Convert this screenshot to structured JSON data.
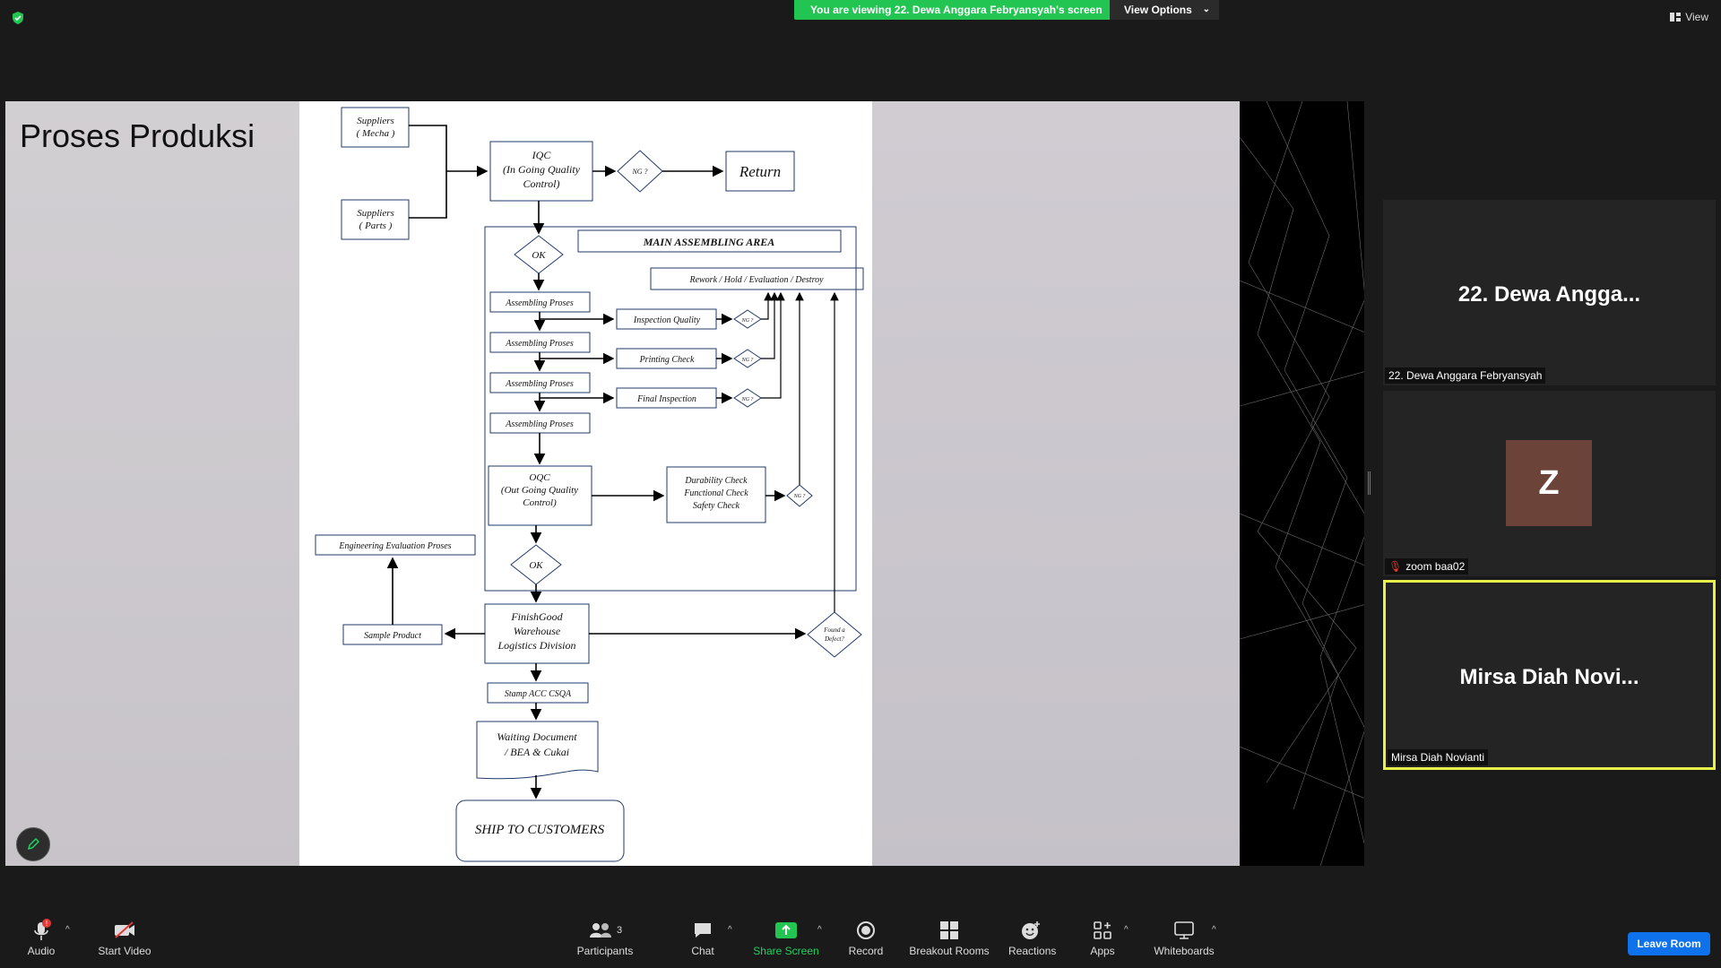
{
  "banner": {
    "text": "You are viewing 22. Dewa Anggara Febryansyah's screen"
  },
  "view_options": {
    "label": "View Options"
  },
  "view_button": {
    "label": "View"
  },
  "slide": {
    "title": "Proses Produksi",
    "flowchart": {
      "suppliers_mecha": [
        "Suppliers",
        "( Mecha )"
      ],
      "suppliers_parts": [
        "Suppliers",
        "( Parts )"
      ],
      "iqc": [
        "IQC",
        "(In Going Quality",
        "Control)"
      ],
      "ng": "NG ?",
      "return": "Return",
      "main_area": "MAIN ASSEMBLING AREA",
      "ok": "OK",
      "rework": "Rework / Hold / Evaluation / Destroy",
      "assembling": "Assembling Proses",
      "inspection_quality": "Inspection Quality",
      "printing_check": "Printing Check",
      "final_inspection": "Final Inspection",
      "oqc": [
        "OQC",
        "(Out Going Quality",
        "Control)"
      ],
      "durability": [
        "Durability Check",
        "Functional Check",
        "Safety Check"
      ],
      "engineering": "Engineering Evaluation Proses",
      "sample_product": "Sample Product",
      "finishgood": [
        "FinishGood",
        "Warehouse",
        "Logistics Division"
      ],
      "found_defect": [
        "Found a",
        "Defect?"
      ],
      "stamp": "Stamp ACC CSQA",
      "waiting": [
        "Waiting Document",
        "/ BEA & Cukai"
      ],
      "ship": "SHIP TO CUSTOMERS"
    }
  },
  "participants_panel": [
    {
      "display_name": "22. Dewa Angga...",
      "label": "22. Dewa Anggara Febryansyah"
    },
    {
      "avatar_letter": "Z",
      "label": "zoom baa02"
    },
    {
      "display_name": "Mirsa Diah Novi...",
      "label": "Mirsa Diah Novianti"
    }
  ],
  "toolbar": {
    "audio": "Audio",
    "start_video": "Start Video",
    "participants": "Participants",
    "participants_count": "3",
    "chat": "Chat",
    "share_screen": "Share Screen",
    "record": "Record",
    "breakout_rooms": "Breakout Rooms",
    "reactions": "Reactions",
    "apps": "Apps",
    "whiteboards": "Whiteboards",
    "leave_room": "Leave Room",
    "audio_badge": "!"
  },
  "colors": {
    "banner_green": "#23c552",
    "leave_blue": "#0e72ed",
    "active_border": "#e8f04a"
  }
}
